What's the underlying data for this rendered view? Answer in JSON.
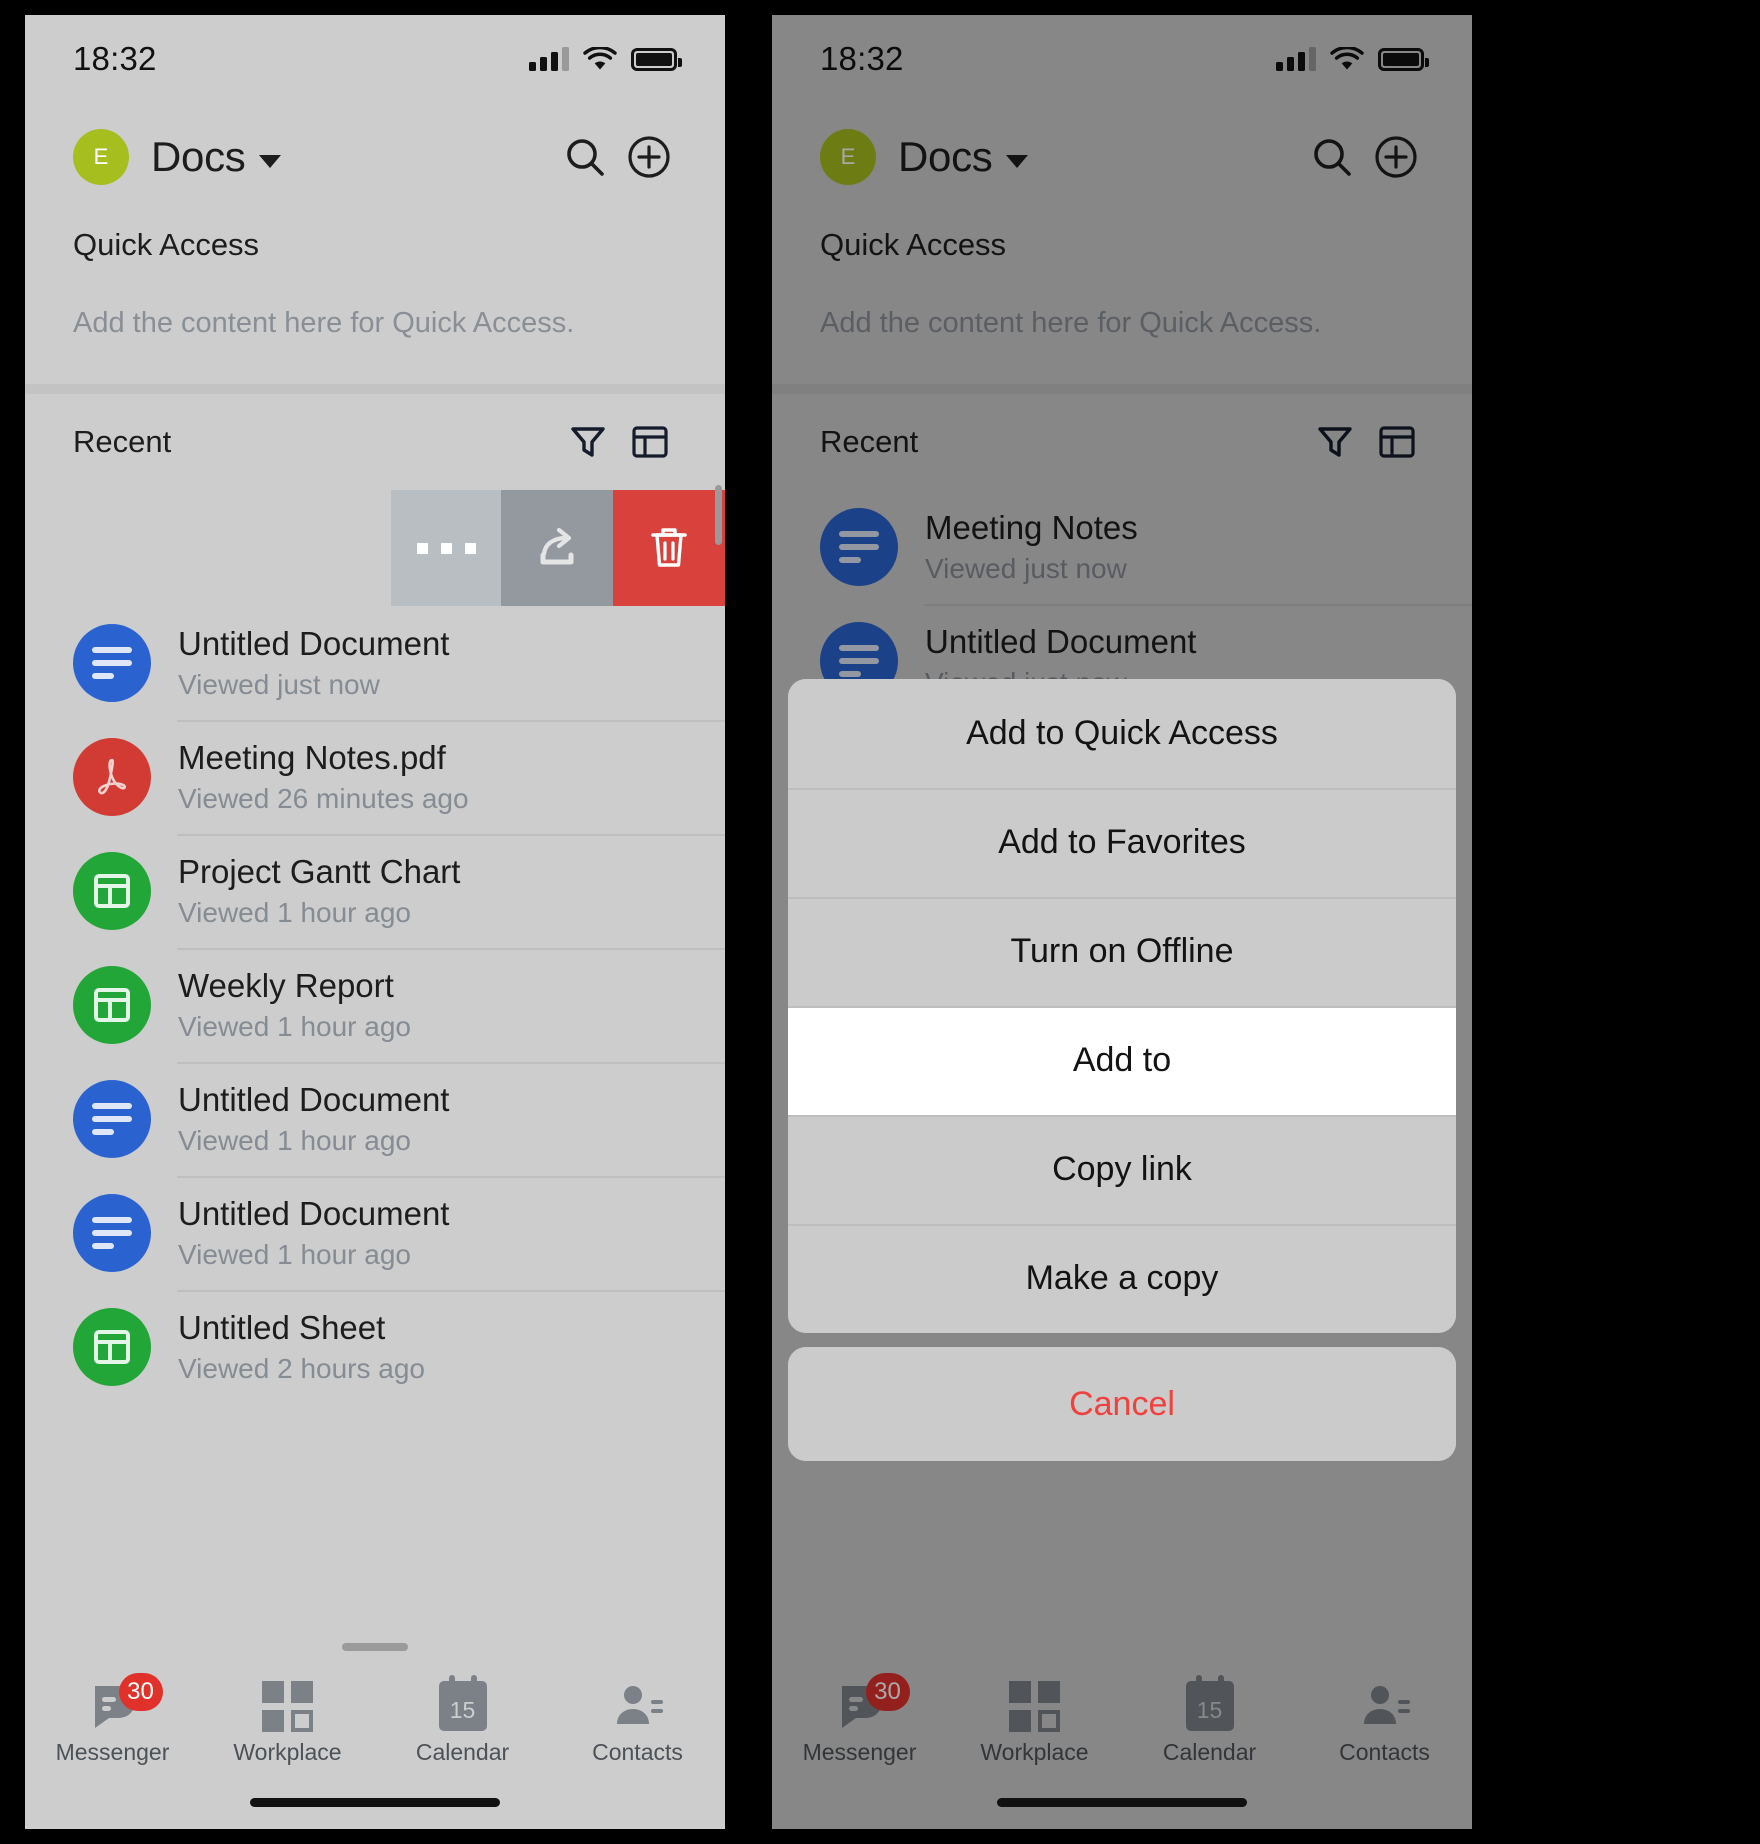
{
  "status_bar": {
    "time": "18:32",
    "signal_icon": "cellular-signal-icon",
    "wifi_icon": "wifi-icon",
    "battery_icon": "battery-full-icon"
  },
  "header": {
    "avatar_initial": "E",
    "title": "Docs",
    "caret_icon": "chevron-down-icon",
    "search_icon": "search-icon",
    "add_icon": "plus-circle-icon"
  },
  "quick_access": {
    "title": "Quick Access",
    "empty_text": "Add the content here for Quick Access."
  },
  "recent": {
    "title": "Recent",
    "filter_icon": "filter-icon",
    "view_icon": "grid-view-icon"
  },
  "swipe_actions": {
    "more_icon": "ellipsis-icon",
    "more_label": "More",
    "share_icon": "share-icon",
    "share_label": "Share",
    "delete_icon": "trash-icon",
    "delete_label": "Delete"
  },
  "left_files": [
    {
      "name": "Untitled Document",
      "sub": "Viewed just now",
      "kind": "doc"
    },
    {
      "name": "Meeting Notes.pdf",
      "sub": "Viewed 26 minutes ago",
      "kind": "pdf"
    },
    {
      "name": "Project Gantt Chart",
      "sub": "Viewed 1 hour ago",
      "kind": "sheet"
    },
    {
      "name": "Weekly Report",
      "sub": "Viewed 1 hour ago",
      "kind": "sheet"
    },
    {
      "name": "Untitled Document",
      "sub": "Viewed 1 hour ago",
      "kind": "doc"
    },
    {
      "name": "Untitled Document",
      "sub": "Viewed 1 hour ago",
      "kind": "doc"
    },
    {
      "name": "Untitled Sheet",
      "sub": "Viewed 2 hours ago",
      "kind": "sheet"
    }
  ],
  "right_files": [
    {
      "name": "Meeting Notes",
      "sub": "Viewed just now",
      "kind": "doc"
    },
    {
      "name": "Untitled Document",
      "sub": "Viewed just now",
      "kind": "doc"
    }
  ],
  "action_sheet": {
    "items": [
      {
        "label": "Add to Quick Access",
        "active": false
      },
      {
        "label": "Add to Favorites",
        "active": false
      },
      {
        "label": "Turn on Offline",
        "active": false
      },
      {
        "label": "Add to",
        "active": true
      },
      {
        "label": "Copy link",
        "active": false
      },
      {
        "label": "Make a copy",
        "active": false
      }
    ],
    "cancel_label": "Cancel",
    "cancel_color": "#f0413c"
  },
  "tabs": [
    {
      "label": "Messenger",
      "icon": "messenger-icon",
      "badge": "30"
    },
    {
      "label": "Workplace",
      "icon": "workplace-grid-icon",
      "badge": ""
    },
    {
      "label": "Calendar",
      "icon": "calendar-icon",
      "badge": "",
      "day": "15"
    },
    {
      "label": "Contacts",
      "icon": "contacts-icon",
      "badge": ""
    }
  ],
  "colors": {
    "doc_blue": "#2a63d0",
    "pdf_red": "#d13b34",
    "sheet_green": "#21a637",
    "avatar_green": "#a6be1e",
    "delete_red": "#d8413c",
    "badge_red": "#e0312b"
  }
}
